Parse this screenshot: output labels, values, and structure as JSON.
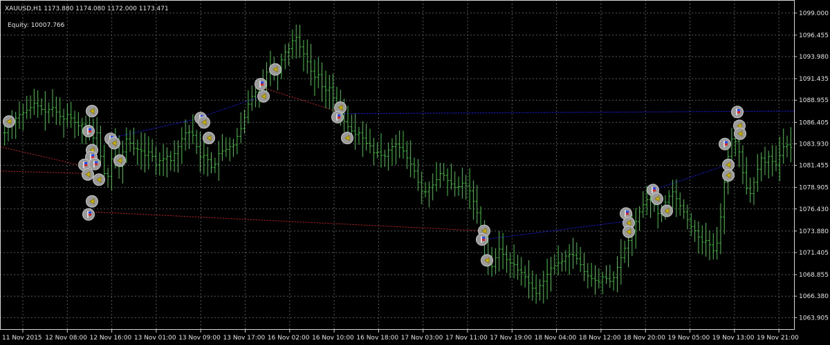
{
  "header": {
    "symbol_line": "XAUUSD,H1  1173.880 1174.080 1172.000 1173.471",
    "equity_line": "Equity: 10007.766"
  },
  "colors": {
    "background": "#000000",
    "grid": "#5a5a5a",
    "frame": "#d9d9d9",
    "candle": "#3dcc3d",
    "text": "#e6e6e6",
    "red_line": "#cc2222",
    "blue_line": "#1a1aff",
    "marker_bg": "#9a9a9a",
    "marker_arrow": "#c9b300"
  },
  "chart_data": {
    "type": "bar",
    "title": "XAUUSD,H1",
    "ylim": [
      1062.5,
      1100.5
    ],
    "y_ticks": [
      "1099.000",
      "1096.455",
      "1093.980",
      "1091.435",
      "1088.955",
      "1086.405",
      "1083.930",
      "1081.455",
      "1078.905",
      "1076.430",
      "1073.880",
      "1071.405",
      "1068.855",
      "1066.380",
      "1063.905"
    ],
    "x_ticks": [
      "11 Nov 2015",
      "12 Nov 08:00",
      "12 Nov 16:00",
      "13 Nov 01:00",
      "13 Nov 09:00",
      "13 Nov 17:00",
      "16 Nov 02:00",
      "16 Nov 10:00",
      "16 Nov 18:00",
      "17 Nov 03:00",
      "17 Nov 11:00",
      "17 Nov 19:00",
      "18 Nov 04:00",
      "18 Nov 12:00",
      "18 Nov 20:00",
      "19 Nov 05:00",
      "19 Nov 13:00",
      "19 Nov 21:00"
    ],
    "closes": [
      1085.2,
      1085.9,
      1086.5,
      1086.9,
      1087.3,
      1087.5,
      1087.8,
      1088.1,
      1088.6,
      1088.3,
      1087.9,
      1087.6,
      1087.9,
      1088.1,
      1087.6,
      1087.1,
      1086.8,
      1087.3,
      1086.9,
      1086.4,
      1086.0,
      1086.2,
      1085.9,
      1085.3,
      1084.6,
      1085.2,
      1082.5,
      1080.5,
      1080.2,
      1082.2,
      1083.6,
      1081.3,
      1083.0,
      1084.5,
      1084.0,
      1083.4,
      1083.3,
      1083.1,
      1082.6,
      1083.0,
      1082.5,
      1081.5,
      1082.0,
      1082.2,
      1082.5,
      1082.0,
      1082.8,
      1083.6,
      1084.5,
      1085.2,
      1085.3,
      1084.9,
      1083.6,
      1082.4,
      1082.6,
      1082.1,
      1081.2,
      1081.6,
      1082.8,
      1083.1,
      1083.3,
      1083.6,
      1083.8,
      1084.8,
      1085.7,
      1087.0,
      1088.5,
      1089.4,
      1089.9,
      1090.6,
      1091.2,
      1092.2,
      1092.9,
      1092.4,
      1092.1,
      1093.6,
      1094.5,
      1094.9,
      1095.8,
      1096.2,
      1095.1,
      1094.3,
      1093.4,
      1092.3,
      1091.6,
      1091.9,
      1090.5,
      1090.1,
      1090.4,
      1089.2,
      1088.0,
      1087.5,
      1086.5,
      1085.9,
      1085.4,
      1085.0,
      1085.2,
      1084.6,
      1084.0,
      1083.7,
      1082.9,
      1083.0,
      1082.6,
      1082.5,
      1083.2,
      1083.6,
      1083.9,
      1083.5,
      1083.1,
      1082.3,
      1081.6,
      1080.8,
      1079.5,
      1078.4,
      1078.4,
      1078.9,
      1079.2,
      1079.8,
      1080.5,
      1080.3,
      1079.7,
      1079.3,
      1078.9,
      1079.0,
      1079.4,
      1079.1,
      1078.5,
      1077.3,
      1076.0,
      1074.3,
      1072.8,
      1071.0,
      1069.8,
      1070.8,
      1071.8,
      1071.2,
      1070.6,
      1070.2,
      1070.0,
      1069.4,
      1069.1,
      1068.6,
      1067.9,
      1067.3,
      1066.7,
      1067.6,
      1068.1,
      1068.9,
      1069.6,
      1069.9,
      1070.2,
      1070.4,
      1071.0,
      1071.2,
      1071.1,
      1070.7,
      1070.0,
      1069.2,
      1068.7,
      1068.4,
      1068.2,
      1068.0,
      1068.6,
      1068.4,
      1068.1,
      1068.5,
      1069.7,
      1070.8,
      1071.9,
      1072.8,
      1073.9,
      1075.0,
      1076.1,
      1076.9,
      1077.5,
      1077.8,
      1076.9,
      1075.9,
      1076.3,
      1077.2,
      1077.9,
      1078.4,
      1077.6,
      1076.8,
      1076.1,
      1075.2,
      1074.4,
      1073.9,
      1073.2,
      1072.6,
      1072.8,
      1072.3,
      1071.6,
      1072.5,
      1075.5,
      1079.5,
      1082.5,
      1084.5,
      1084.2,
      1083.0,
      1080.6,
      1078.8,
      1078.2,
      1079.5,
      1081.0,
      1082.3,
      1081.8,
      1082.5,
      1081.9,
      1081.5,
      1082.6,
      1083.6,
      1083.8,
      1083.5
    ]
  },
  "trade_lines": [
    {
      "type": "red",
      "points": [
        [
          1079.8,
          1078.8
        ]
      ]
    }
  ]
}
